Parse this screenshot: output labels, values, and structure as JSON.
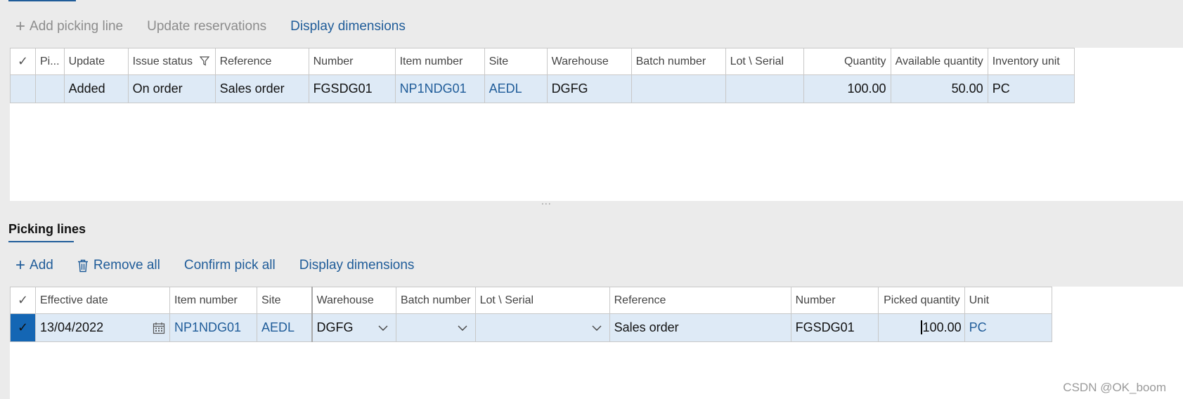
{
  "top_toolbar": {
    "add_picking_line": "Add picking line",
    "update_reservations": "Update reservations",
    "display_dimensions": "Display dimensions"
  },
  "upper_grid": {
    "headers": [
      "Pi...",
      "Update",
      "Issue status",
      "Reference",
      "Number",
      "Item number",
      "Site",
      "Warehouse",
      "Batch number",
      "Lot \\ Serial",
      "Quantity",
      "Available quantity",
      "Inventory unit"
    ],
    "row": {
      "pi": "",
      "update": "Added",
      "issue_status": "On order",
      "reference": "Sales order",
      "number": "FGSDG01",
      "item_number": "NP1NDG01",
      "site": "AEDL",
      "warehouse": "DGFG",
      "batch_number": "",
      "lot_serial": "",
      "quantity": "100.00",
      "available_quantity": "50.00",
      "inventory_unit": "PC"
    }
  },
  "splitter": "...",
  "picking_lines": {
    "title": "Picking lines",
    "toolbar": {
      "add": "Add",
      "remove_all": "Remove all",
      "confirm_pick_all": "Confirm pick all",
      "display_dimensions": "Display dimensions"
    },
    "headers": [
      "Effective date",
      "Item number",
      "Site",
      "Warehouse",
      "Batch number",
      "Lot \\ Serial",
      "Reference",
      "Number",
      "Picked quantity",
      "Unit"
    ],
    "row": {
      "effective_date": "13/04/2022",
      "item_number": "NP1NDG01",
      "site": "AEDL",
      "warehouse": "DGFG",
      "batch_number": "",
      "lot_serial": "",
      "reference": "Sales order",
      "number": "FGSDG01",
      "picked_quantity": "100.00",
      "unit": "PC"
    }
  },
  "watermark": "CSDN @OK_boom",
  "colors": {
    "accent": "#1f5c99",
    "selected_row": "#deeaf6",
    "check_selected": "#1466b4"
  }
}
